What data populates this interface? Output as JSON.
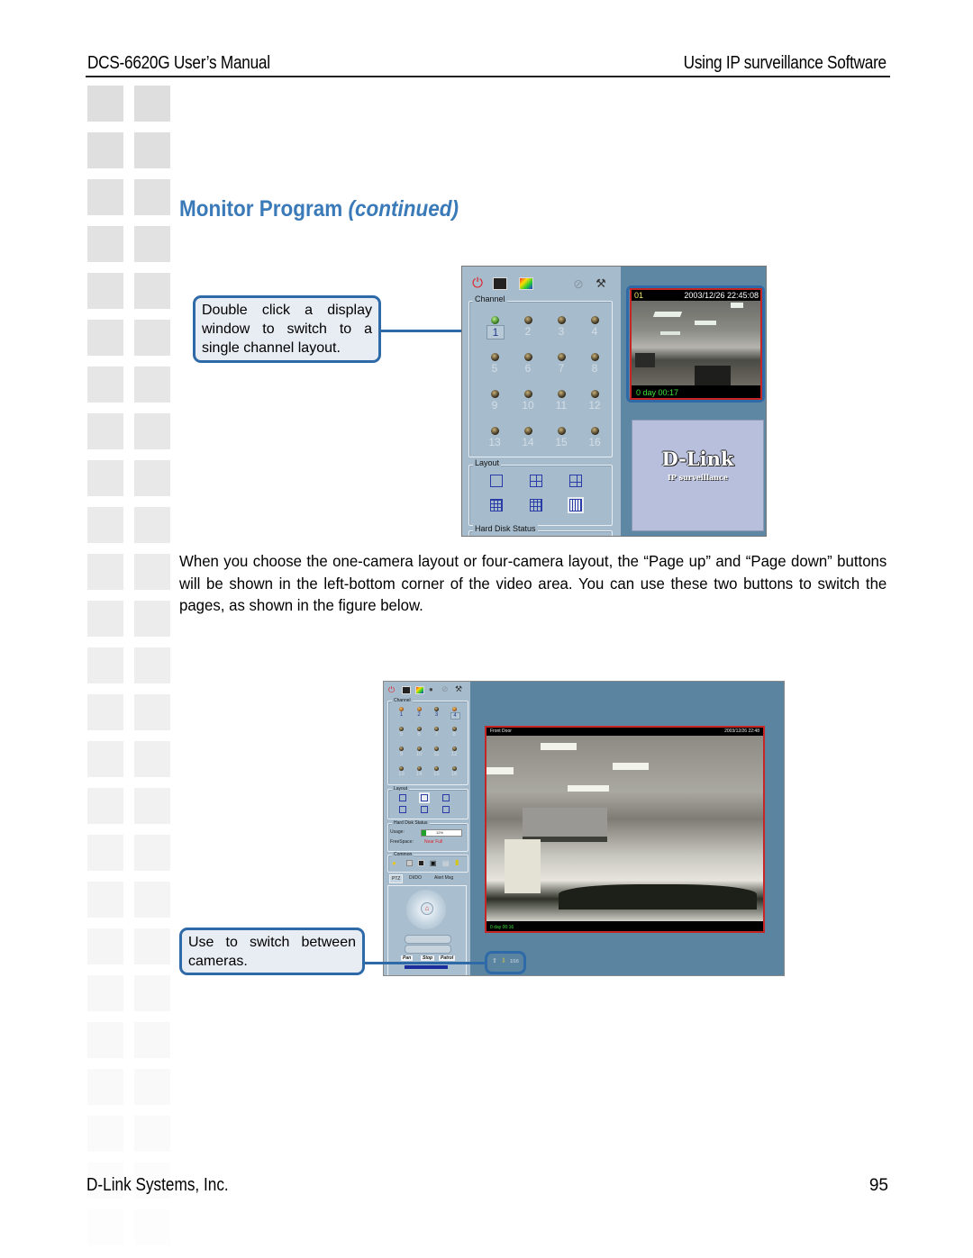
{
  "header": {
    "manual_title": "DCS-6620G User’s Manual",
    "section_title": "Using IP surveillance Software"
  },
  "title": {
    "main": "Monitor Program",
    "suffix": "(continued)"
  },
  "callouts": {
    "double_click": "Double click a display window to switch to a single channel layout.",
    "switch_cameras": "Use to switch between cameras."
  },
  "body_paragraph": "When you choose the one-camera layout or four-camera layout, the “Page up” and “Page down” buttons will be shown in the left-bottom corner of the video area. You can use these two buttons to switch the pages, as shown in the figure below.",
  "footer": {
    "company": "D-Link Systems, Inc.",
    "page_number": "95"
  },
  "screenshot1": {
    "toolbar_icons": [
      "power-icon",
      "monitor-icon",
      "color-monitor-icon",
      "disk-icon",
      "tools-icon"
    ],
    "channel_label": "Channel",
    "channels": [
      "1",
      "2",
      "3",
      "4",
      "5",
      "6",
      "7",
      "8",
      "9",
      "10",
      "11",
      "12",
      "13",
      "14",
      "15",
      "16"
    ],
    "active_channel": "1",
    "layout_label": "Layout",
    "hard_disk_label": "Hard Disk Status",
    "video": {
      "channel_id": "01",
      "timestamp": "2003/12/26 22:45:08",
      "uptime": "0 day  00:17"
    },
    "logo": {
      "brand": "D-Link",
      "subtitle": "IP surveillance"
    }
  },
  "screenshot2": {
    "channel_label": "Channel",
    "channels": [
      "1",
      "2",
      "3",
      "4",
      "5",
      "6",
      "7",
      "8",
      "9",
      "10",
      "11",
      "12",
      "13",
      "14",
      "15",
      "16"
    ],
    "selected_channel": "4",
    "layout_label": "Layout",
    "hard_disk_label": "Hard Disk Status",
    "usage_label": "Usage:",
    "usage_value": "12%",
    "usage_percent": 12,
    "free_space_label": "FreeSpace:",
    "free_space_value": "Near Full",
    "common_label": "Common",
    "tabs": [
      "PTZ",
      "DI/DO",
      "Alert Msg"
    ],
    "ptz_buttons": [
      "Pan",
      "Stop",
      "Patrol"
    ],
    "video_title": "Front Door",
    "video_timestamp": "2003/12/26 22:48",
    "video_uptime": "0 day 00:16",
    "page_indicator": "1/16"
  },
  "colors": {
    "accent_blue": "#3a7ab8",
    "callout_border": "#2f6aa8",
    "callout_fill": "#e8ecf3",
    "panel_blue": "#a6bccd",
    "video_bg": "#5d87a3",
    "video_border": "#c62525"
  }
}
